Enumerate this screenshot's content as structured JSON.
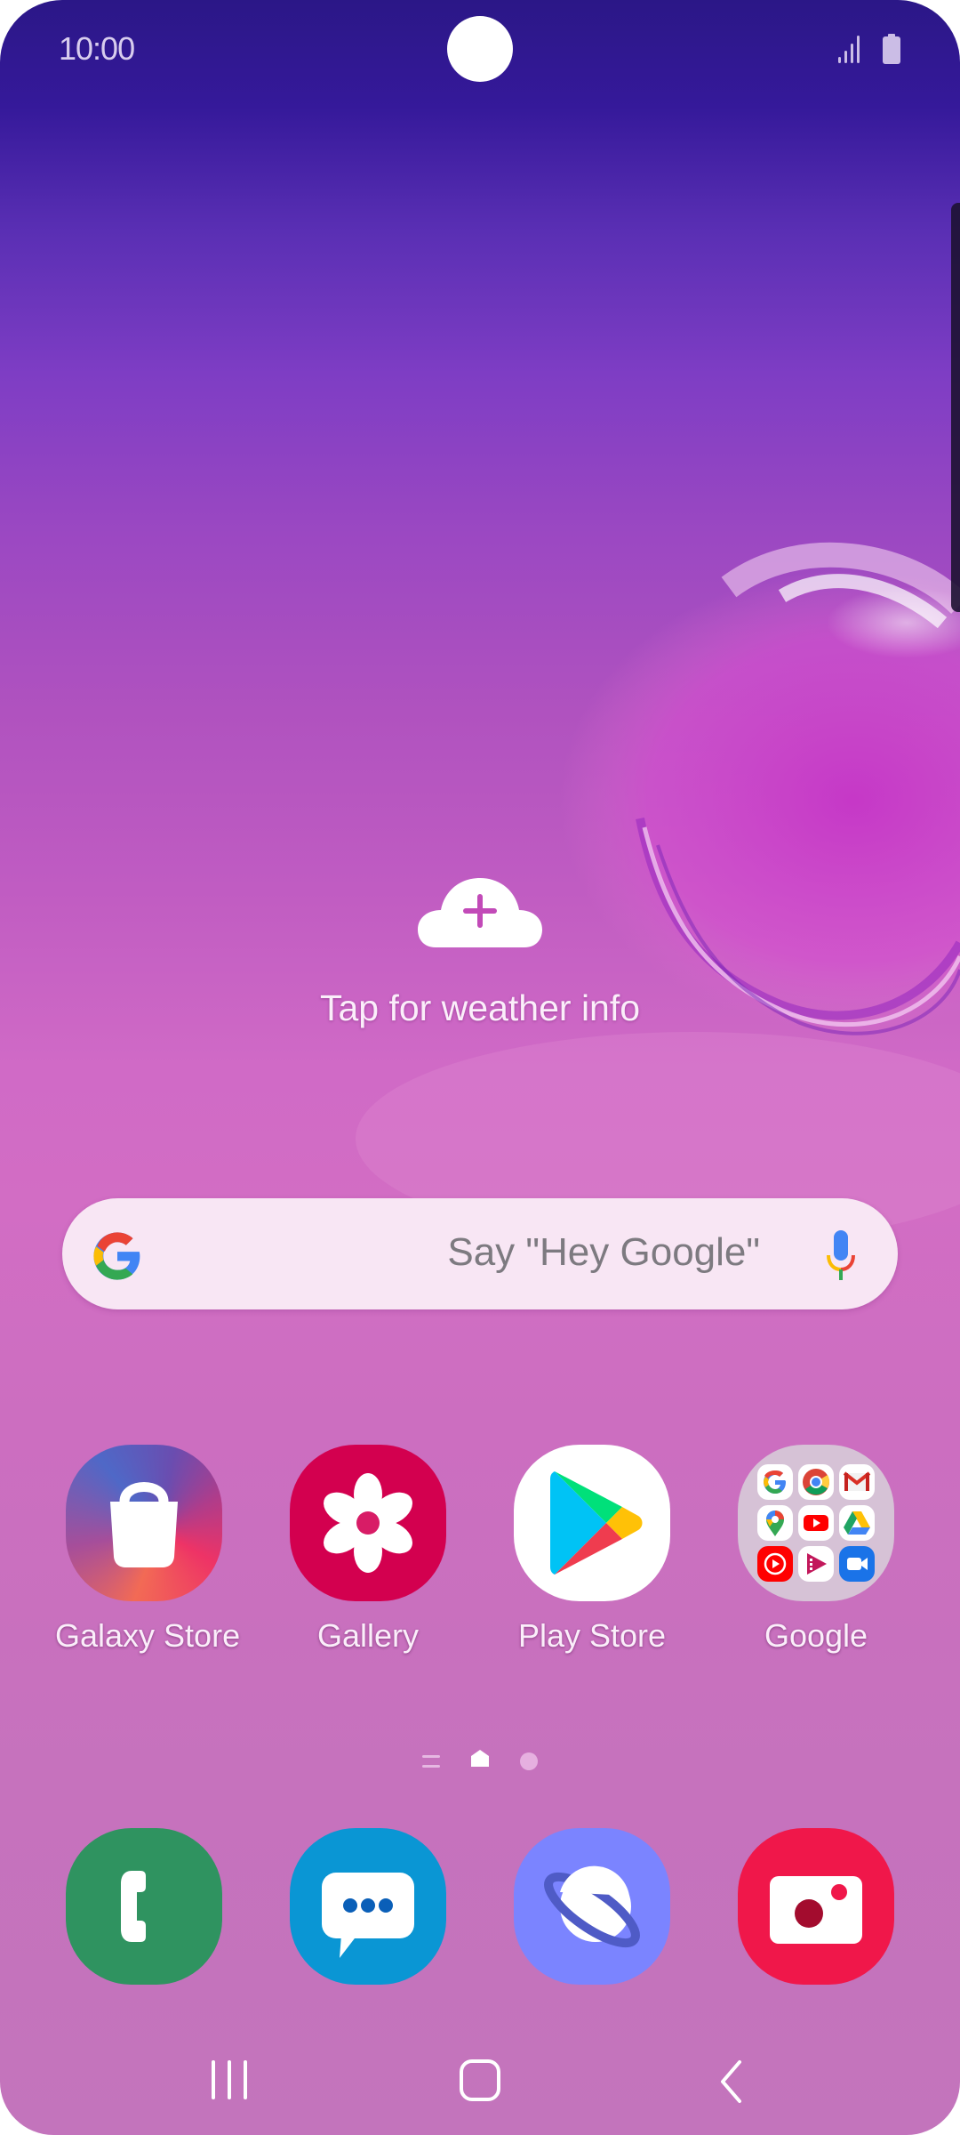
{
  "status_bar": {
    "time": "10:00",
    "icons": [
      "signal-icon",
      "battery-icon"
    ]
  },
  "weather_widget": {
    "icon": "cloud-add-icon",
    "label": "Tap for weather info"
  },
  "search_bar": {
    "logo": "google-g-logo",
    "placeholder": "Say \"Hey Google\"",
    "mic_icon": "microphone-icon"
  },
  "home_apps": [
    {
      "label": "Galaxy Store",
      "icon": "shopping-bag-icon"
    },
    {
      "label": "Gallery",
      "icon": "flower-icon"
    },
    {
      "label": "Play Store",
      "icon": "play-triangle-icon"
    },
    {
      "label": "Google",
      "icon": "folder-icon",
      "folder_contents": [
        "Google",
        "Chrome",
        "Gmail",
        "Maps",
        "YouTube",
        "Drive",
        "YT Music",
        "Play Movies",
        "Duo"
      ]
    }
  ],
  "page_indicator": {
    "items": [
      "menu-lines-icon",
      "home-page-icon",
      "page-dot"
    ],
    "active_index": 1
  },
  "dock": [
    {
      "label": "Phone",
      "icon": "phone-icon",
      "color": "#2f9360"
    },
    {
      "label": "Messages",
      "icon": "chat-bubble-icon",
      "color": "#0a96d4"
    },
    {
      "label": "Internet",
      "icon": "planet-icon",
      "color": "#7b84ff"
    },
    {
      "label": "Camera",
      "icon": "camera-icon",
      "color": "#f0174a"
    }
  ],
  "nav_bar": {
    "recents": "recents-icon",
    "home": "home-icon",
    "back": "back-icon"
  }
}
